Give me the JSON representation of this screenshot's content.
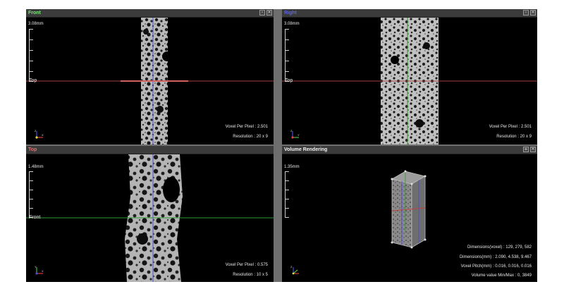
{
  "panes": {
    "front": {
      "title": "Front",
      "title_color": "#7ee07e",
      "scale_label": "3.08mm",
      "ref_label": "Top",
      "line_color": "#a24040",
      "info": [
        "Voxel Per Pixel : 2.501",
        "Resolution : 20 x 9"
      ]
    },
    "right": {
      "title": "Right",
      "title_color": "#5a64e8",
      "scale_label": "3.08mm",
      "ref_label": "Top",
      "line_color": "#a24040",
      "info": [
        "Voxel Per Pixel : 2.501",
        "Resolution : 20 x 9"
      ]
    },
    "top": {
      "title": "Top",
      "title_color": "#e07070",
      "scale_label": "1.48mm",
      "ref_label": "Front",
      "line_color": "#2e9a2e",
      "info": [
        "Voxel Per Pixel : 0.575",
        "Resolution : 10 x 5"
      ]
    },
    "volume": {
      "title": "Volume Rendering",
      "title_color": "#f0f0f0",
      "scale_label": "1.35mm",
      "info": [
        "Dimensions(voxel) : 129, 279, 582",
        "Dimensions(mm) : 2.090, 4.538, 9.467",
        "Voxel Pitch(mm) : 0.016, 0.016, 0.016",
        "Volume value Min/Max : 0, 3849"
      ]
    }
  },
  "icons": {
    "maximize": "+",
    "restore": "▫",
    "close": "✕"
  }
}
